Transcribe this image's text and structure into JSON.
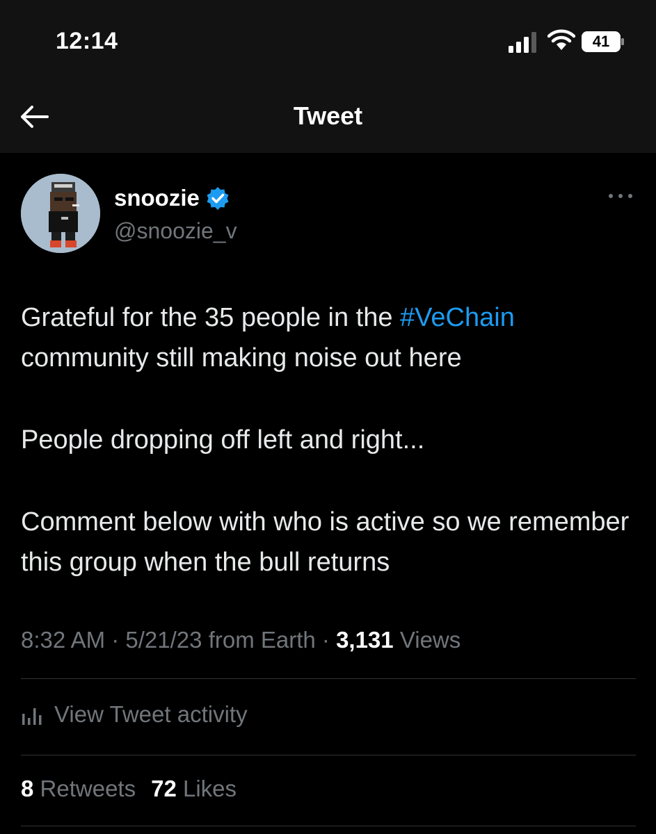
{
  "status_bar": {
    "time": "12:14",
    "battery": "41"
  },
  "header": {
    "title": "Tweet",
    "back_icon": "arrow-left-icon"
  },
  "tweet": {
    "author": {
      "display_name": "snoozie",
      "handle": "@snoozie_v",
      "verified": true
    },
    "text": {
      "line1_before": "Grateful for the 35 people in the ",
      "hashtag": "#VeChain",
      "line1_after": " community still making noise out here",
      "paragraph2": "People dropping off left and right...",
      "paragraph3": "Comment below with who is active so we remember this group when the bull returns"
    },
    "meta": {
      "time": "8:32 AM",
      "date": "5/21/23",
      "source": "from Earth",
      "views_count": "3,131",
      "views_label": "Views",
      "separator": " · "
    },
    "activity_label": "View Tweet activity",
    "stats": {
      "retweets_count": "8",
      "retweets_label": "Retweets",
      "likes_count": "72",
      "likes_label": "Likes"
    }
  },
  "colors": {
    "background": "#000000",
    "header_bg": "#121212",
    "text": "#e7e9ea",
    "secondary": "#71767b",
    "accent": "#1d9bf0",
    "divider": "#2f3336"
  }
}
